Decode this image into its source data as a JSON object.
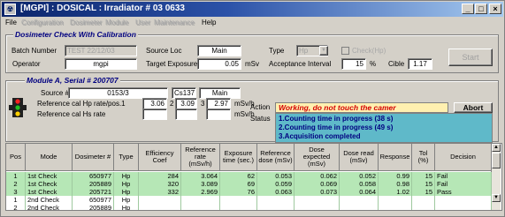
{
  "window": {
    "title": "[MGPI] : DOSICAL : Irradiator # 03 0633",
    "minimize": "_",
    "maximize": "□",
    "close": "×"
  },
  "menu": {
    "file": "File",
    "configuration": "Configuration",
    "dosimeter": "Dosimeter",
    "module": "Module",
    "user": "User",
    "maintenance": "Maintenance",
    "help": "Help"
  },
  "calibration": {
    "group_title": "Dosimeter Check With Calibration",
    "batch_label": "Batch Number",
    "batch_value": "TEST 22/12/03",
    "operator_label": "Operator",
    "operator_value": "mgpi",
    "source_loc_label": "Source Loc",
    "source_loc_value": "Main",
    "target_exposure_label": "Target Exposure",
    "target_exposure_value": "0.05",
    "target_exposure_unit": "mSv",
    "type_label": "Type",
    "type_value": "Hp",
    "cheeck_label": "Check(Hp)",
    "acceptance_label": "Acceptance Interval",
    "acceptance_value": "15",
    "acceptance_unit": "%",
    "cible_label": "Cible",
    "cible_value": "1.17",
    "start_button": "Start"
  },
  "module": {
    "group_title": "Module A, Serial # 200707",
    "source_label": "Source #",
    "source_value": "0153/3",
    "source_iso": "Cs137",
    "source_loc": "Main",
    "ref_hp_label": "Reference cal Hp rate/pos.1",
    "ref_hp_1": "3.06",
    "ref_hp_pos2": "2",
    "ref_hp_2": "3.09",
    "ref_hp_pos3": "3",
    "ref_hp_3": "2.97",
    "ref_hp_unit": "mSv/h",
    "ref_hs_label": "Reference cal Hs rate",
    "ref_hs_unit": "mSv/h",
    "action_label": "Action",
    "action_value": "Working, do not touch the camer",
    "abort_button": "Abort",
    "status_label": "Status",
    "status_lines": [
      "1.Counting time in progress (38 s)",
      "2.Counting time in progress (49 s)",
      "3.Acquisition completed"
    ]
  },
  "table": {
    "headers": [
      "Pos",
      "Mode",
      "Dosimeter #",
      "Type",
      "Efficiency Coef",
      "Reference rate (mSv/h)",
      "Exposure time (sec.)",
      "Reference dose (mSv)",
      "Dose expected (mSv)",
      "Dose read (mSv)",
      "Response",
      "Tol (%)",
      "Decision"
    ],
    "rows": [
      [
        "1",
        "1st Check",
        "650977",
        "Hp",
        "284",
        "3.064",
        "62",
        "0.053",
        "0.062",
        "0.052",
        "0.99",
        "15",
        "Fail"
      ],
      [
        "2",
        "1st Check",
        "205889",
        "Hp",
        "320",
        "3.089",
        "69",
        "0.059",
        "0.069",
        "0.058",
        "0.98",
        "15",
        "Fail"
      ],
      [
        "3",
        "1st Check",
        "205721",
        "Hp",
        "332",
        "2.969",
        "76",
        "0.063",
        "0.073",
        "0.064",
        "1.02",
        "15",
        "Pass"
      ],
      [
        "1",
        "2nd Check",
        "650977",
        "Hp",
        "",
        "",
        "",
        "",
        "",
        "",
        "",
        "",
        ""
      ],
      [
        "2",
        "2nd Check",
        "205889",
        "Hp",
        "",
        "",
        "",
        "",
        "",
        "",
        "",
        "",
        ""
      ]
    ]
  },
  "colors": {
    "title_gradient_start": "#0a246a",
    "row_green": "#b6e7b6",
    "status_bg": "#5fb9c9",
    "action_text": "#d40000"
  }
}
